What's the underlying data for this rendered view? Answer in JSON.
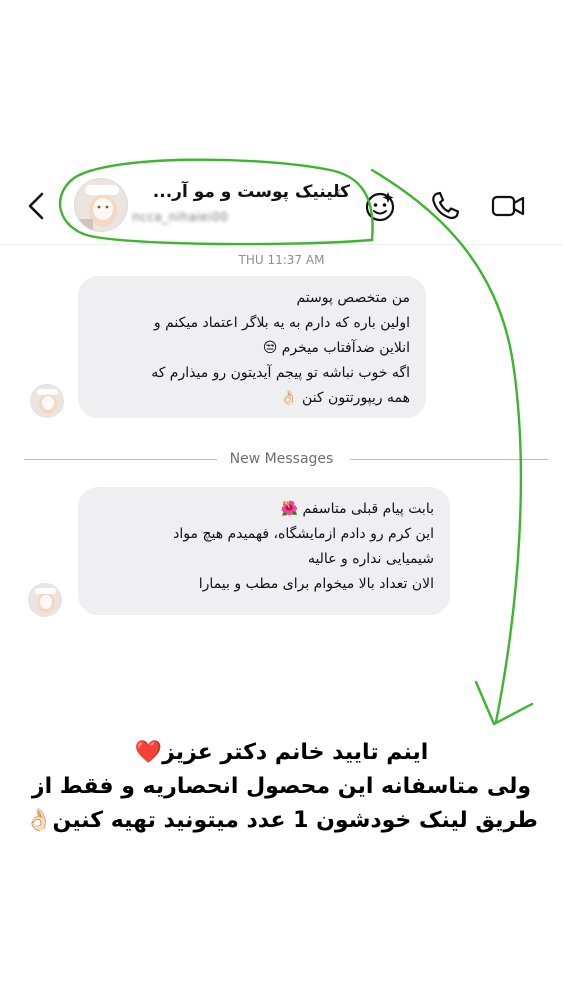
{
  "header": {
    "title": "کلینیک پوست و مو آر...",
    "username": "ncca_nihaiei00",
    "icons": [
      "back-icon",
      "chevron-left-icon",
      "effects-icon",
      "phone-icon",
      "video-icon"
    ]
  },
  "timestamp": "THU 11:37 AM",
  "messages": [
    {
      "lines": [
        "من متخصص پوستم",
        "اولین باره که دارم به یه بلاگر اعتماد میکنم و",
        "انلاین ضدآفتاب میخرم 😒",
        "اگه خوب نباشه تو پیجم آیدیتون رو میذارم که",
        "همه ریپورتتون کنن 👌🏻"
      ]
    },
    {
      "lines": [
        "بابت پیام قبلی متاسفم 🌺",
        "این کرم رو دادم ازمایشگاه، فهمیدم هیچ مواد",
        "شیمیایی نداره و عالیه",
        "الان تعداد بالا میخوام برای مطب و بیمارا"
      ]
    }
  ],
  "new_messages_label": "New Messages",
  "caption": {
    "lines": [
      "اینم تایید خانم دکتر عزیز❤️",
      "ولی متاسفانه این محصول انحصاریه و فقط از",
      "طریق لینک خودشون 1 عدد میتونید تهیه کنین👌🏻"
    ]
  },
  "annotation_color": "#3db52f"
}
